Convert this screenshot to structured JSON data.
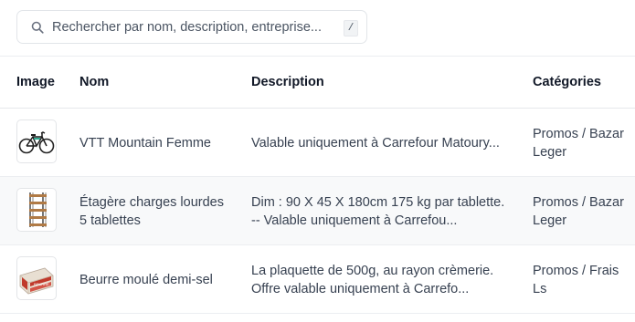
{
  "search": {
    "placeholder": "Rechercher par nom, description, entreprise...",
    "shortcut": "/"
  },
  "table": {
    "headers": {
      "image": "Image",
      "name": "Nom",
      "description": "Description",
      "categories": "Catégories"
    },
    "rows": [
      {
        "image_icon": "bike-icon",
        "name": [
          "VTT Mountain Femme"
        ],
        "description": [
          "Valable uniquement à Carrefour Matoury..."
        ],
        "categories": [
          "Promos / Bazar",
          "Leger"
        ]
      },
      {
        "image_icon": "shelf-icon",
        "name": [
          "Étagère charges lourdes",
          "5 tablettes"
        ],
        "description": [
          "Dim : 90 X 45 X 180cm 175 kg par tablette.",
          "-- Valable uniquement à Carrefou..."
        ],
        "categories": [
          "Promos / Bazar",
          "Leger"
        ]
      },
      {
        "image_icon": "butter-icon",
        "name": [
          "Beurre moulé demi-sel"
        ],
        "description": [
          "La plaquette de 500g, au rayon crèmerie.",
          "Offre valable uniquement à Carrefo..."
        ],
        "categories": [
          "Promos / Frais",
          "Ls"
        ]
      }
    ]
  }
}
